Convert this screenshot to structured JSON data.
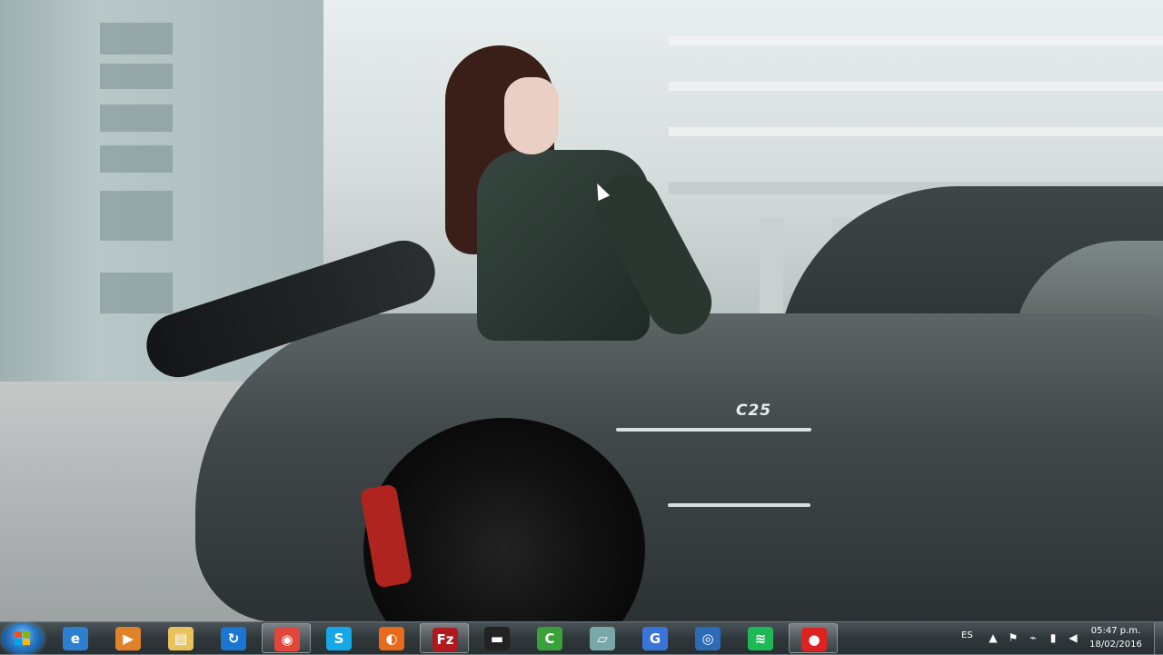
{
  "wallpaper": {
    "badge_text": "C25"
  },
  "taskbar": {
    "start": {
      "icon": "windows-start-orb"
    },
    "pinned": [
      {
        "id": "ie",
        "icon": "internet-explorer-icon",
        "glyph": "e",
        "color": "#2f7fd1"
      },
      {
        "id": "media",
        "icon": "media-player-icon",
        "glyph": "▶",
        "color": "#e0822a"
      },
      {
        "id": "explorer",
        "icon": "file-explorer-icon",
        "glyph": "▤",
        "color": "#e8c25b"
      },
      {
        "id": "ccleaner",
        "icon": "refresh-app-icon",
        "glyph": "↻",
        "color": "#1b76d1"
      },
      {
        "id": "chrome",
        "icon": "chrome-icon",
        "glyph": "◉",
        "color": "#e0463a",
        "active": true
      },
      {
        "id": "skype",
        "icon": "skype-icon",
        "glyph": "S",
        "color": "#14a8e8"
      },
      {
        "id": "firefox",
        "icon": "firefox-icon",
        "glyph": "◐",
        "color": "#e86a1c"
      },
      {
        "id": "filezilla",
        "icon": "filezilla-icon",
        "glyph": "Fz",
        "color": "#b0191e",
        "active": true
      },
      {
        "id": "device",
        "icon": "device-icon",
        "glyph": "▬",
        "color": "#222"
      },
      {
        "id": "camtasia",
        "icon": "camtasia-icon",
        "glyph": "C",
        "color": "#3aa13a"
      },
      {
        "id": "notepad",
        "icon": "notepad-icon",
        "glyph": "▱",
        "color": "#7aa7a8"
      },
      {
        "id": "app-blue",
        "icon": "blue-app-icon",
        "glyph": "G",
        "color": "#3b74d8"
      },
      {
        "id": "disc",
        "icon": "disc-app-icon",
        "glyph": "◎",
        "color": "#2c6bb7"
      },
      {
        "id": "spotify",
        "icon": "spotify-icon",
        "glyph": "≋",
        "color": "#1db954"
      },
      {
        "id": "record",
        "icon": "record-icon",
        "glyph": "●",
        "color": "#d22",
        "active": true
      }
    ],
    "tray": {
      "language": "ES",
      "icons": [
        "chevron-up-icon",
        "flag-icon",
        "plug-icon",
        "signal-icon",
        "volume-icon"
      ],
      "time": "05:47 p.m.",
      "date": "18/02/2016"
    }
  }
}
